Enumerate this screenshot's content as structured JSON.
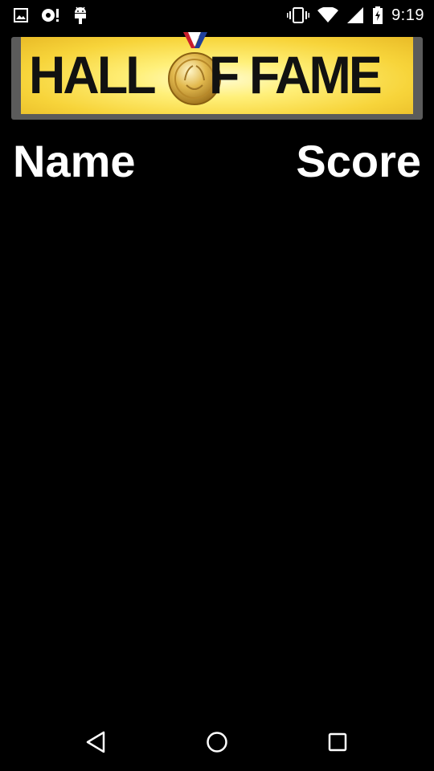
{
  "status_bar": {
    "time": "9:19",
    "left_icons": [
      "image-icon",
      "sync-alert-icon",
      "android-debug-icon"
    ],
    "right_icons": [
      "vibrate-icon",
      "wifi-icon",
      "signal-icon",
      "battery-charging-icon"
    ]
  },
  "banner": {
    "left_text": "HALL",
    "right_text": "F FAME",
    "medal_icon": "gold-medal-icon",
    "colors": {
      "gold_light": "#fff07a",
      "gold_dark": "#e9bb27",
      "frame": "#5b5b5b"
    }
  },
  "table": {
    "headers": {
      "name": "Name",
      "score": "Score"
    },
    "rows": []
  },
  "nav_bar": {
    "buttons": [
      "back-icon",
      "home-icon",
      "recents-icon"
    ]
  }
}
